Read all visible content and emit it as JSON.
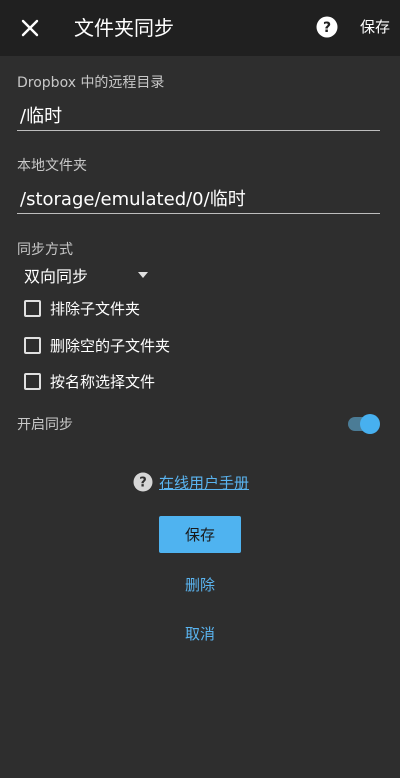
{
  "appbar": {
    "title": "文件夹同步",
    "save_label": "保存"
  },
  "remote": {
    "label": "Dropbox 中的远程目录",
    "value": "/临时"
  },
  "local": {
    "label": "本地文件夹",
    "value": "/storage/emulated/0/临时"
  },
  "sync_method": {
    "label": "同步方式",
    "selected": "双向同步"
  },
  "options": [
    {
      "label": "排除子文件夹",
      "checked": false
    },
    {
      "label": "删除空的子文件夹",
      "checked": false
    },
    {
      "label": "按名称选择文件",
      "checked": false
    }
  ],
  "enable_sync": {
    "label": "开启同步",
    "on": true
  },
  "manual": {
    "link_label": "在线用户手册"
  },
  "actions": {
    "save_label": "保存",
    "delete_label": "删除",
    "cancel_label": "取消"
  },
  "colors": {
    "accent": "#4fb3f0",
    "background": "#2e2e2e",
    "appbar": "#202020"
  }
}
